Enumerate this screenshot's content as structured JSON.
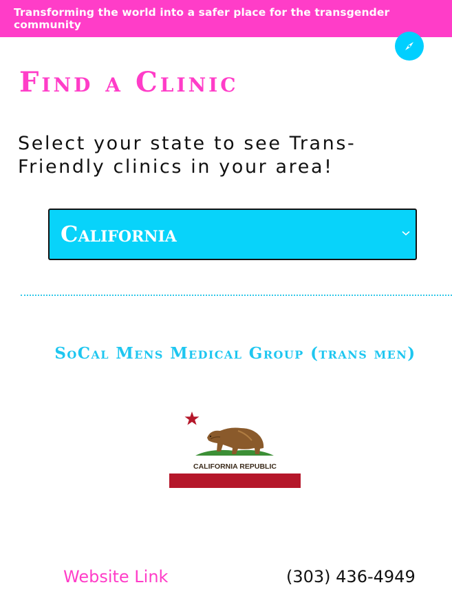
{
  "header": {
    "banner_text": "Transforming the world into a safer place for the transgender community",
    "nav_icon": "compass-icon",
    "banner_color": "#ff3dc8",
    "accent_color": "#00cfff"
  },
  "main": {
    "title": "Find a Clinic",
    "subtitle_line1": "Select your state to see Trans-",
    "subtitle_line2": "Friendly clinics in your area!",
    "state_select": {
      "selected": "California",
      "icon": "chevron-down-icon"
    }
  },
  "clinic": {
    "name": "SoCal Mens Medical Group (trans men)",
    "image": {
      "description_icon": "california-flag-icon",
      "flag_text": "CALIFORNIA REPUBLIC"
    },
    "website_label": "Website Link",
    "phone": "(303) 436-4949"
  }
}
